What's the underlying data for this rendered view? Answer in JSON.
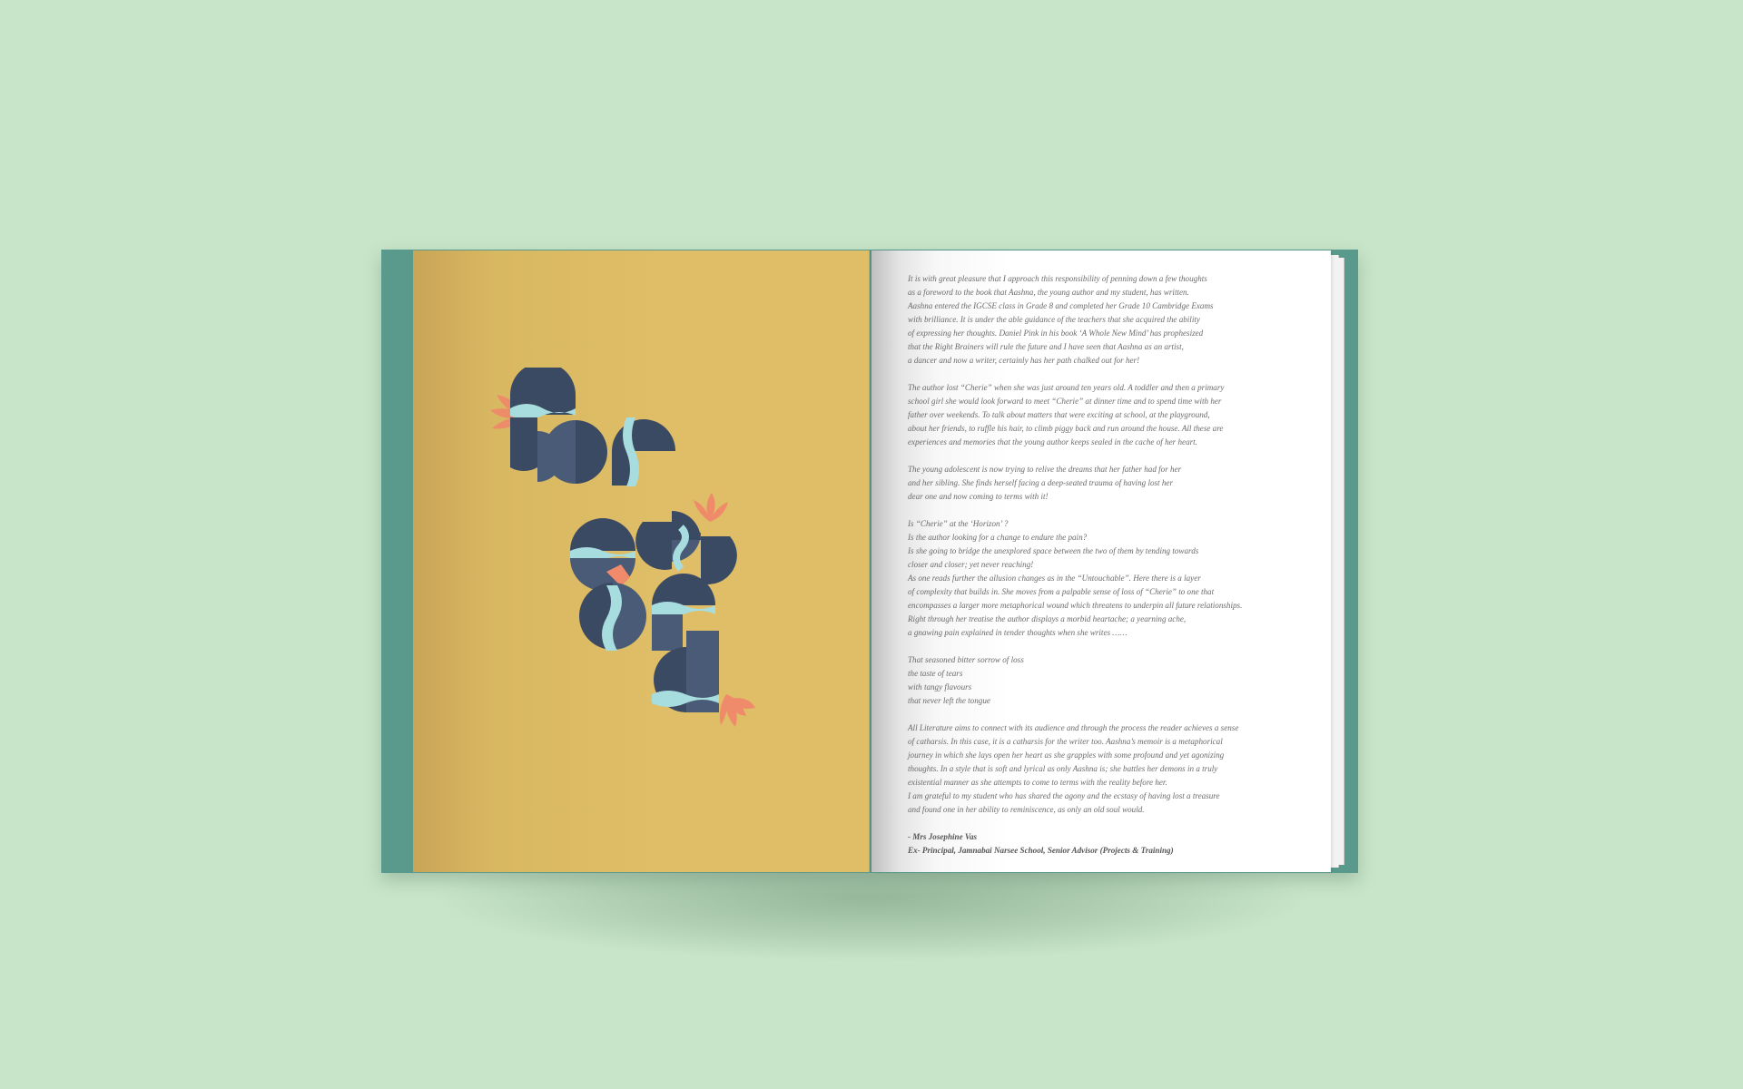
{
  "book": {
    "left_page": {
      "title_art_text": "Foreword",
      "colors": {
        "page": "#dfbe67",
        "letters": "#3b4a63",
        "letters_light": "#4a5b77",
        "waves": "#a8dde0",
        "lotus": "#ef8a6a",
        "cover": "#5a9a8c"
      }
    },
    "right_page": {
      "paragraphs": [
        "It is with great pleasure that I approach this responsibility of penning down a few thoughts\nas a foreword to the book that Aashna, the young author and my student, has written.\nAashna entered the IGCSE class in Grade 8 and completed her Grade 10 Cambridge Exams\nwith brilliance. It is under the able guidance of the teachers that she acquired the ability\nof expressing her thoughts. Daniel Pink in his book ‘A Whole New Mind’ has prophesized\nthat the Right Brainers will rule the future and I have seen that Aashna as an artist,\na dancer and now a writer, certainly has her path chalked out for her!",
        "The author lost “Cherie” when she was just around ten years old. A toddler and then a primary\nschool girl she would look forward to meet “Cherie” at dinner time and to spend time with her\nfather over weekends. To talk about matters that were exciting at school, at the playground,\nabout her friends, to ruffle his hair, to climb piggy back and run around the house. All these are\nexperiences and memories that the young author keeps sealed in the cache of her heart.",
        "The young adolescent is now trying to relive the dreams that her father had for her\nand her sibling. She finds herself facing a deep-seated trauma of having lost her\ndear one and now coming to terms with it!",
        "Is “Cherie” at the ‘Horizon’ ?\nIs the author looking for a change to endure the pain?\nIs she going to bridge the unexplored space between the two of them by tending towards\ncloser and closer; yet never reaching!\nAs one reads further the allusion changes as in the “Untouchable”. Here there is a layer\nof complexity that builds in. She moves from a palpable sense of loss of “Cherie” to one that\nencompasses a larger more metaphorical wound which threatens to underpin all future relationships.\nRight through her treatise the author displays a morbid heartache; a yearning ache,\na gnawing pain explained in tender thoughts when she writes ……",
        "That seasoned bitter sorrow of loss\nthe taste of tears\nwith tangy flavours\nthat never left the tongue",
        "All Literature aims to connect with its audience and through the process the reader achieves a sense\nof catharsis. In this case, it is a catharsis for the writer too. Aashna’s memoir is a metaphorical\njourney in which she lays open her heart as she grapples with some profound and yet agonizing\nthoughts. In a style that is soft and lyrical as only Aashna is; she battles her demons in a truly\nexistential manner as she attempts to come to terms with the reality before her.\nI am grateful to my student who has shared the agony and the ecstasy of having lost a treasure\nand found one in her ability to reminiscence, as only an old soul would."
      ],
      "signature_name": "- Mrs Josephine Vas",
      "signature_title": "Ex- Principal, Jamnabai Narsee School, Senior Advisor (Projects & Training)"
    }
  }
}
